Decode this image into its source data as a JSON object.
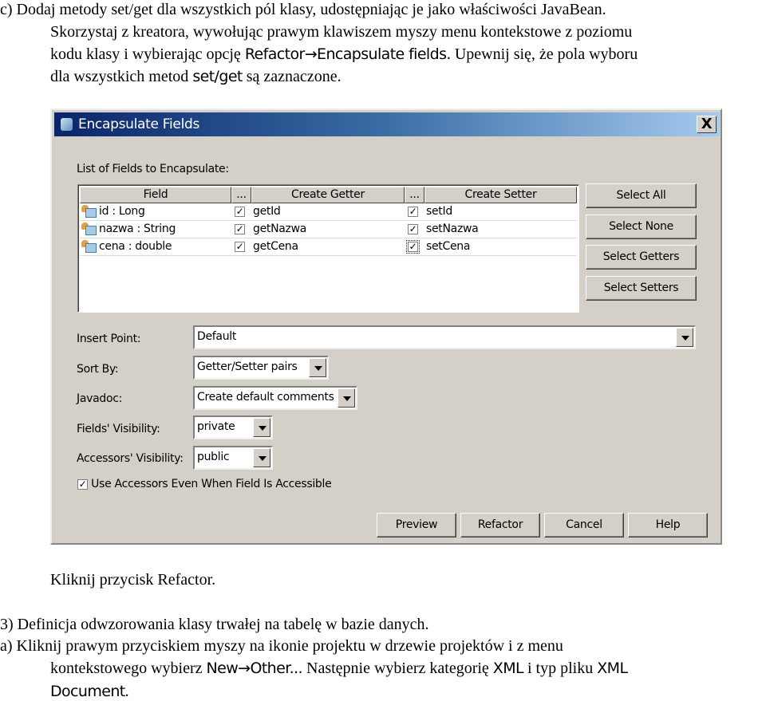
{
  "doc": {
    "intro": {
      "l1": "c)  Dodaj metody set/get dla wszystkich pól klasy, udostępniając je jako właściwości JavaBean.",
      "l2": "Skorzystaj z kreatora, wywołując prawym klawiszem myszy menu kontekstowe z poziomu",
      "l3a": "kodu klasy i wybierając opcję ",
      "l3b": "Refactor→Encapsulate fields.",
      "l3c": " Upewnij się, że pola wyboru",
      "l4a": "dla wszystkich metod ",
      "l4b": "set/get",
      "l4c": " są zaznaczone."
    },
    "after": "Kliknij przycisk Refactor.",
    "s3": "3) Definicja odwzorowania klasy trwałej na tabelę w bazie danych.",
    "a1": "a)  Kliknij prawym przyciskiem myszy na ikonie projektu w drzewie projektów i z menu",
    "a2a": "kontekstowego wybierz ",
    "a2b": "New→Other...",
    "a2c": " Następnie wybierz kategorię ",
    "a2d": "XML",
    "a2e": " i typ pliku ",
    "a2f": "XML",
    "a3a": "Document",
    "a3b": "."
  },
  "dialog": {
    "title": "Encapsulate Fields",
    "close": "X",
    "list_label": "List of Fields to Encapsulate:",
    "columns": [
      "Field",
      "...",
      "Create Getter",
      "...",
      "Create Setter"
    ],
    "rows": [
      {
        "field": "id : Long",
        "getter_checked": true,
        "getter": "getId",
        "setter_checked": true,
        "setter": "setId"
      },
      {
        "field": "nazwa : String",
        "getter_checked": true,
        "getter": "getNazwa",
        "setter_checked": true,
        "setter": "setNazwa"
      },
      {
        "field": "cena : double",
        "getter_checked": true,
        "getter": "getCena",
        "setter_checked": true,
        "setter": "setCena"
      }
    ],
    "side_buttons": [
      "Select All",
      "Select None",
      "Select Getters",
      "Select Setters"
    ],
    "insert_point": {
      "label": "Insert Point:",
      "value": "Default"
    },
    "sort_by": {
      "label": "Sort By:",
      "value": "Getter/Setter pairs"
    },
    "javadoc": {
      "label": "Javadoc:",
      "value": "Create default comments"
    },
    "fields_visibility": {
      "label": "Fields' Visibility:",
      "value": "private"
    },
    "accessors_visibility": {
      "label": "Accessors' Visibility:",
      "value": "public"
    },
    "use_accessors": {
      "label": "Use Accessors Even When Field Is Accessible",
      "checked": true
    },
    "buttons": [
      "Preview",
      "Refactor",
      "Cancel",
      "Help"
    ]
  }
}
